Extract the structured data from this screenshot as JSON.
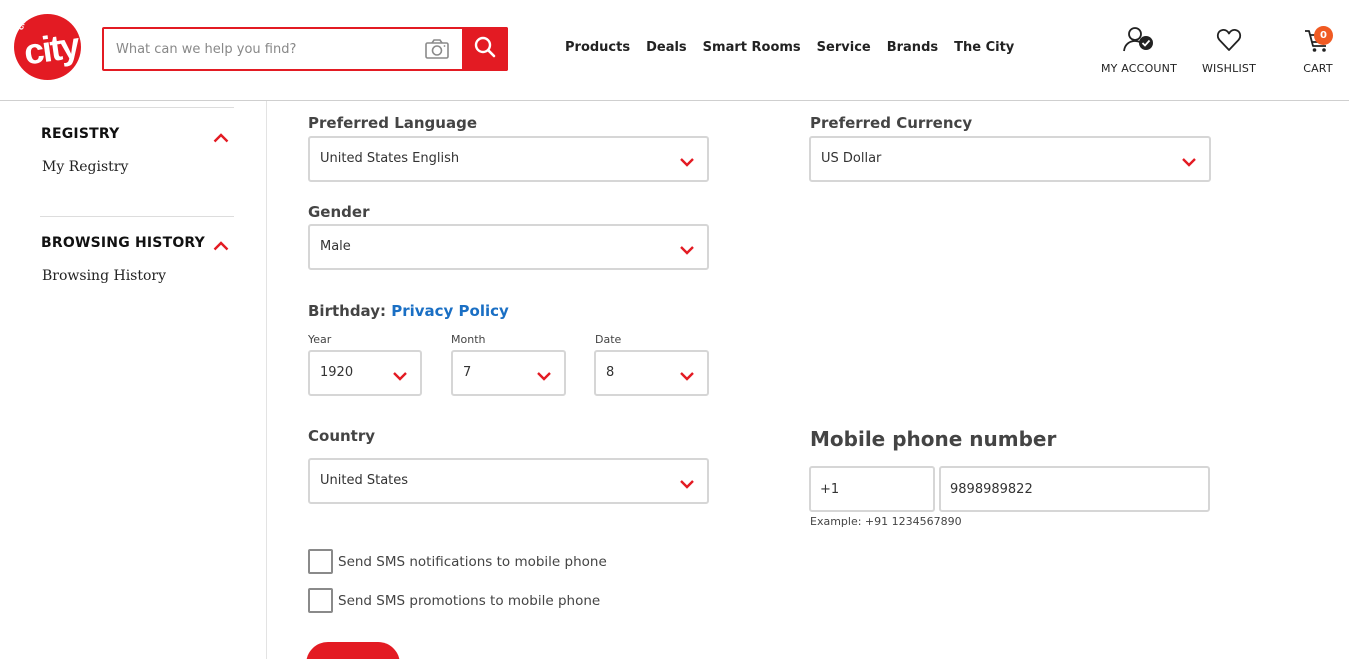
{
  "brand": {
    "logo_small": "circuit",
    "logo_big": "city",
    "accent_color": "#e31b23",
    "badge_color": "#f05a22",
    "link_color": "#1a6fc4"
  },
  "search": {
    "placeholder": "What can we help you find?",
    "camera_icon": "camera-icon",
    "search_icon": "search-icon"
  },
  "nav": {
    "items": [
      "Products",
      "Deals",
      "Smart Rooms",
      "Service",
      "Brands",
      "The City"
    ]
  },
  "header_tools": {
    "account_label": "MY ACCOUNT",
    "wishlist_label": "WISHLIST",
    "cart_label": "CART",
    "cart_count": "0"
  },
  "sidebar": {
    "sections": [
      {
        "heading": "REGISTRY",
        "expanded": true,
        "links": [
          "My Registry"
        ]
      },
      {
        "heading": "BROWSING HISTORY",
        "expanded": true,
        "links": [
          "Browsing History"
        ]
      }
    ]
  },
  "form": {
    "language": {
      "label": "Preferred Language",
      "value": "United States English"
    },
    "currency": {
      "label": "Preferred Currency",
      "value": "US Dollar"
    },
    "gender": {
      "label": "Gender",
      "value": "Male"
    },
    "birthday": {
      "label": "Birthday:",
      "privacy_link": "Privacy Policy",
      "year": {
        "label": "Year",
        "value": "1920"
      },
      "month": {
        "label": "Month",
        "value": "7"
      },
      "date": {
        "label": "Date",
        "value": "8"
      }
    },
    "country": {
      "label": "Country",
      "value": "United States"
    },
    "mobile": {
      "title": "Mobile phone number",
      "country_code": "+1",
      "number": "9898989822",
      "example": "Example: +91 1234567890"
    },
    "sms_notifications": {
      "label": "Send SMS notifications to mobile phone",
      "checked": false
    },
    "sms_promotions": {
      "label": "Send SMS promotions to mobile phone",
      "checked": false
    }
  }
}
